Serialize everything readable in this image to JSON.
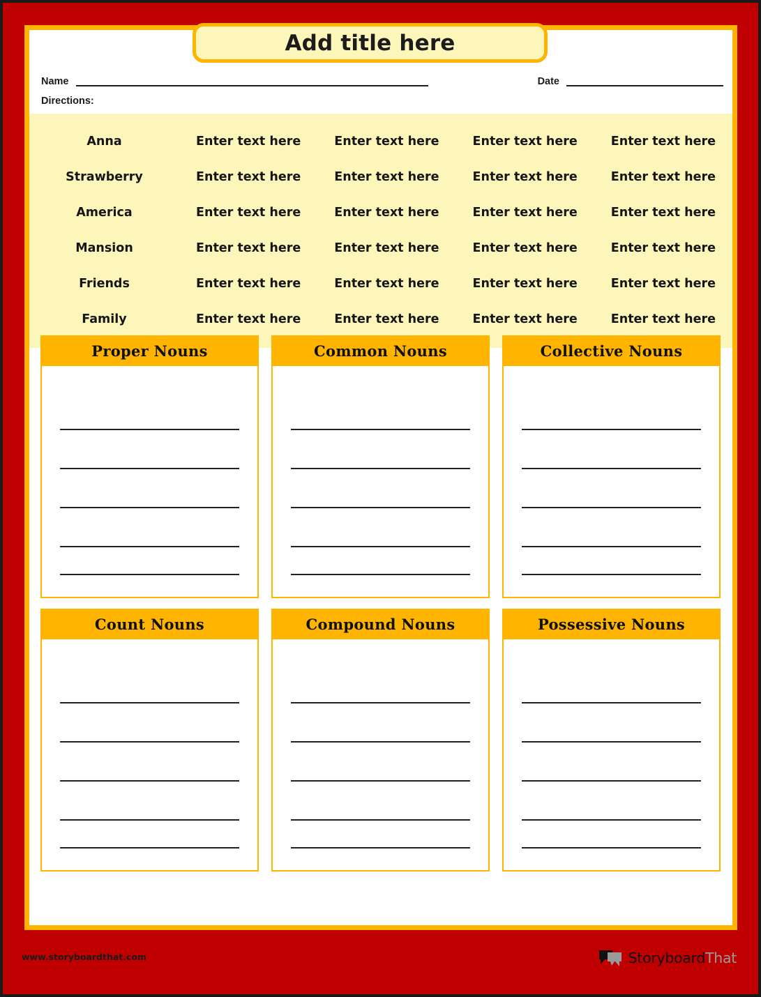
{
  "worksheet": {
    "title": "Add title here",
    "name_label": "Name",
    "date_label": "Date",
    "directions_label": "Directions:"
  },
  "word_bank": {
    "placeholder": "Enter text here",
    "rows": [
      {
        "word": "Anna",
        "c2": "Enter text here",
        "c3": "Enter text here",
        "c4": "Enter text here",
        "c5": "Enter text here"
      },
      {
        "word": "Strawberry",
        "c2": "Enter text here",
        "c3": "Enter text here",
        "c4": "Enter text here",
        "c5": "Enter text here"
      },
      {
        "word": "America",
        "c2": "Enter text here",
        "c3": "Enter text here",
        "c4": "Enter text here",
        "c5": "Enter text here"
      },
      {
        "word": "Mansion",
        "c2": "Enter text here",
        "c3": "Enter text here",
        "c4": "Enter text here",
        "c5": "Enter text here"
      },
      {
        "word": "Friends",
        "c2": "Enter text here",
        "c3": "Enter text here",
        "c4": "Enter text here",
        "c5": "Enter text here"
      },
      {
        "word": "Family",
        "c2": "Enter text here",
        "c3": "Enter text here",
        "c4": "Enter text here",
        "c5": "Enter text here"
      }
    ]
  },
  "categories": [
    {
      "title": "Proper Nouns",
      "lines": 5
    },
    {
      "title": "Common Nouns",
      "lines": 5
    },
    {
      "title": "Collective Nouns",
      "lines": 5
    },
    {
      "title": "Count Nouns",
      "lines": 5
    },
    {
      "title": "Compound Nouns",
      "lines": 5
    },
    {
      "title": "Possessive Nouns",
      "lines": 5
    }
  ],
  "footer": {
    "url": "www.storyboardthat.com",
    "logo_primary": "Storyboard",
    "logo_secondary": "That"
  },
  "colors": {
    "red": "#c00000",
    "orange": "#ffb400",
    "pale_yellow": "#fdf6ba",
    "ink": "#1c1c1c"
  }
}
